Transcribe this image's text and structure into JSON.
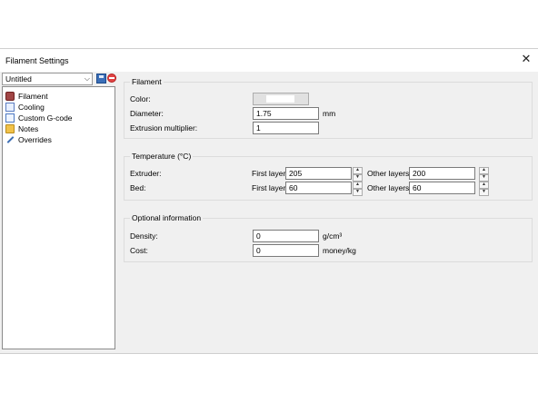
{
  "window": {
    "title": "Filament Settings",
    "close_glyph": "✕"
  },
  "preset": {
    "value": "Untitled",
    "save_icon": "save-icon",
    "delete_icon": "delete-icon"
  },
  "tree": {
    "items": [
      {
        "label": "Filament",
        "icon": "filament-icon"
      },
      {
        "label": "Cooling",
        "icon": "cooling-icon"
      },
      {
        "label": "Custom G-code",
        "icon": "gcode-icon"
      },
      {
        "label": "Notes",
        "icon": "notes-icon"
      },
      {
        "label": "Overrides",
        "icon": "wrench-icon"
      }
    ]
  },
  "filament": {
    "title": "Filament",
    "color_label": "Color:",
    "color_value": "#ffffff",
    "diameter_label": "Diameter:",
    "diameter_value": "1.75",
    "diameter_unit": "mm",
    "extrusion_label": "Extrusion multiplier:",
    "extrusion_value": "1"
  },
  "temperature": {
    "title": "Temperature (°C)",
    "extruder_label": "Extruder:",
    "bed_label": "Bed:",
    "first_layer_label": "First layer:",
    "other_layers_label": "Other layers:",
    "extruder_first": "205",
    "extruder_other": "200",
    "bed_first": "60",
    "bed_other": "60"
  },
  "optional": {
    "title": "Optional information",
    "density_label": "Density:",
    "density_value": "0",
    "density_unit": "g/cm³",
    "cost_label": "Cost:",
    "cost_value": "0",
    "cost_unit": "money/kg"
  }
}
